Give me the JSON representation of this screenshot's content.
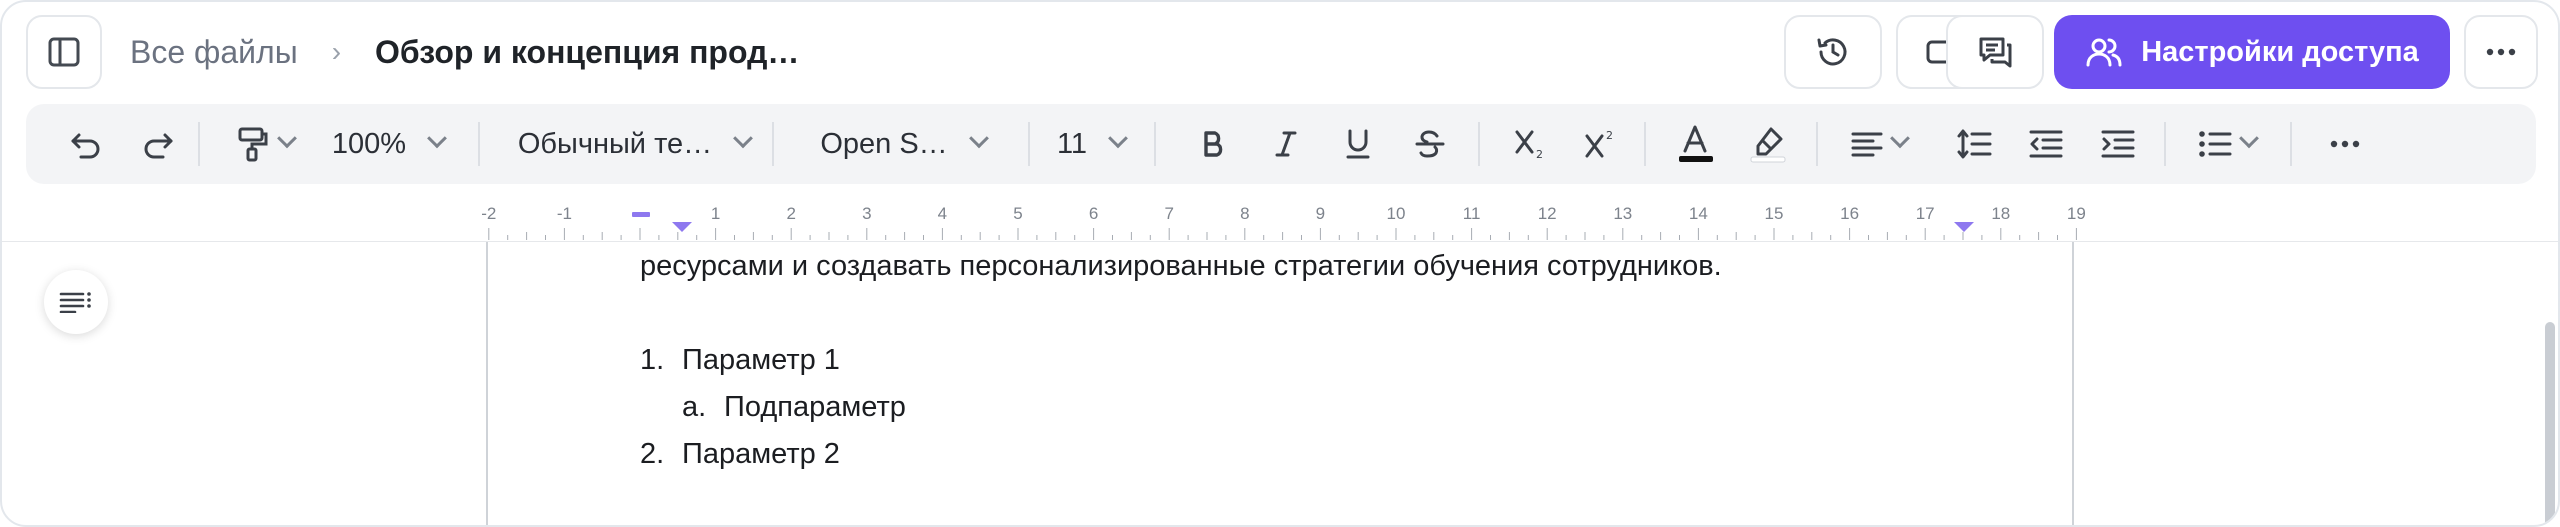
{
  "header": {
    "breadcrumb_root": "Все файлы",
    "breadcrumb_separator": "›",
    "document_title": "Обзор и концепция прод…",
    "share_button_label": "Настройки доступа",
    "accent_color": "#6e4ff0"
  },
  "toolbar": {
    "zoom": "100%",
    "paragraph_style": "Обычный те…",
    "font_name": "Open S…",
    "font_size": "11"
  },
  "ruler": {
    "numbers": [
      "-2",
      "-1",
      "1",
      "2",
      "3",
      "4",
      "5",
      "6",
      "7",
      "8",
      "9",
      "10",
      "11",
      "12",
      "13",
      "14",
      "15",
      "16",
      "17",
      "18",
      "19"
    ]
  },
  "document": {
    "intro_line": "ресурсами и создавать персонализированные стратегии обучения сотрудников.",
    "list": [
      {
        "marker": "1.",
        "text": "Параметр 1"
      },
      {
        "marker": "a.",
        "text": "Подпараметр"
      },
      {
        "marker": "2.",
        "text": "Параметр 2"
      }
    ]
  },
  "icons": {
    "sidebar": "sidebar-icon",
    "history": "history-icon",
    "video": "video-icon",
    "comments": "comments-icon",
    "share": "users-icon",
    "more": "more-icon",
    "undo": "undo-icon",
    "redo": "redo-icon",
    "format_painter": "paint-roller-icon",
    "bold": "bold-icon",
    "italic": "italic-icon",
    "underline": "underline-icon",
    "strike": "strikethrough-icon",
    "subscript": "subscript-icon",
    "superscript": "superscript-icon",
    "text_color": "text-color-icon",
    "highlight": "highlighter-icon",
    "align": "align-left-icon",
    "line_height": "line-spacing-icon",
    "outdent": "outdent-icon",
    "indent": "indent-icon",
    "list": "bullet-list-icon",
    "outline": "outline-icon"
  }
}
